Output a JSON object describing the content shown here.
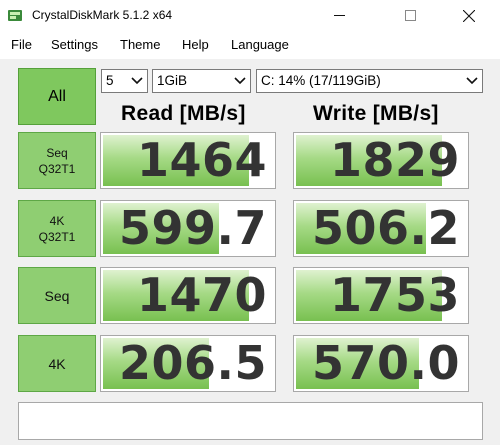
{
  "window": {
    "title": "CrystalDiskMark 5.1.2 x64",
    "icon": "crystaldiskmark-icon"
  },
  "menu": [
    "File",
    "Settings",
    "Theme",
    "Help",
    "Language"
  ],
  "controls": {
    "all_label": "All",
    "count": "5",
    "size": "1GiB",
    "drive": "C: 14% (17/119GiB)"
  },
  "headers": {
    "read": "Read [MB/s]",
    "write": "Write [MB/s]"
  },
  "tests": [
    {
      "label_line1": "Seq",
      "label_line2": "Q32T1",
      "read": "1464",
      "write": "1829",
      "read_fill": 0.86,
      "write_fill": 0.86
    },
    {
      "label_line1": "4K",
      "label_line2": "Q32T1",
      "read": "599.7",
      "write": "506.2",
      "read_fill": 0.69,
      "write_fill": 0.77
    },
    {
      "label_line1": "Seq",
      "label_line2": "",
      "read": "1470",
      "write": "1753",
      "read_fill": 0.86,
      "write_fill": 0.86
    },
    {
      "label_line1": "4K",
      "label_line2": "",
      "read": "206.5",
      "write": "570.0",
      "read_fill": 0.63,
      "write_fill": 0.73
    }
  ],
  "comment": "",
  "colors": {
    "button_green": "#8fce72",
    "bar_green": "#78c050"
  }
}
